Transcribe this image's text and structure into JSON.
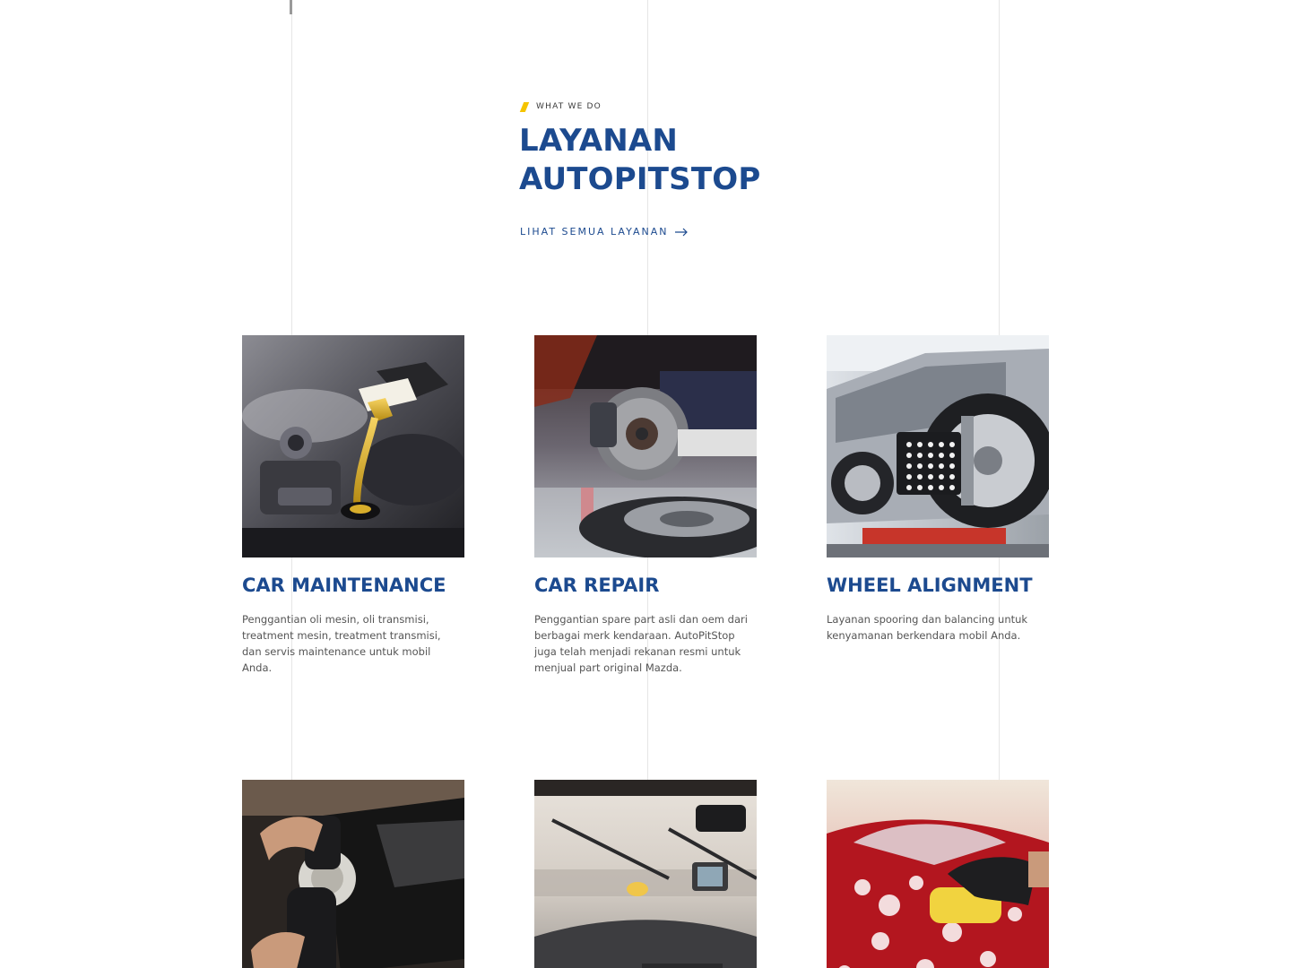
{
  "section": {
    "eyebrow": "WHAT WE DO",
    "title_line1": "LAYANAN",
    "title_line2": "AUTOPITSTOP",
    "view_all_label": "LIHAT SEMUA LAYANAN",
    "view_all_icon": "arrow-right-icon"
  },
  "colors": {
    "brand_blue": "#1c4a8f",
    "accent_yellow": "#f5c400",
    "body_text": "#555555"
  },
  "services": [
    {
      "title": "CAR MAINTENANCE",
      "description": "Penggantian oli mesin, oli transmisi, treatment mesin, treatment transmisi, dan servis maintenance untuk mobil Anda.",
      "image": "oil-pouring-engine-photo"
    },
    {
      "title": "CAR REPAIR",
      "description": "Penggantian spare part asli dan oem dari berbagai merk kendaraan. AutoPitStop juga telah menjadi rekanan resmi untuk menjual part original Mazda.",
      "image": "brake-disc-repair-photo"
    },
    {
      "title": "WHEEL ALIGNMENT",
      "description": "Layanan spooring dan balancing untuk kenyamanan berkendara mobil Anda.",
      "image": "wheel-alignment-clamp-photo"
    },
    {
      "title": "",
      "description": "",
      "image": "car-polishing-photo"
    },
    {
      "title": "",
      "description": "",
      "image": "windshield-wiper-photo"
    },
    {
      "title": "",
      "description": "",
      "image": "car-wash-sponge-photo"
    }
  ]
}
